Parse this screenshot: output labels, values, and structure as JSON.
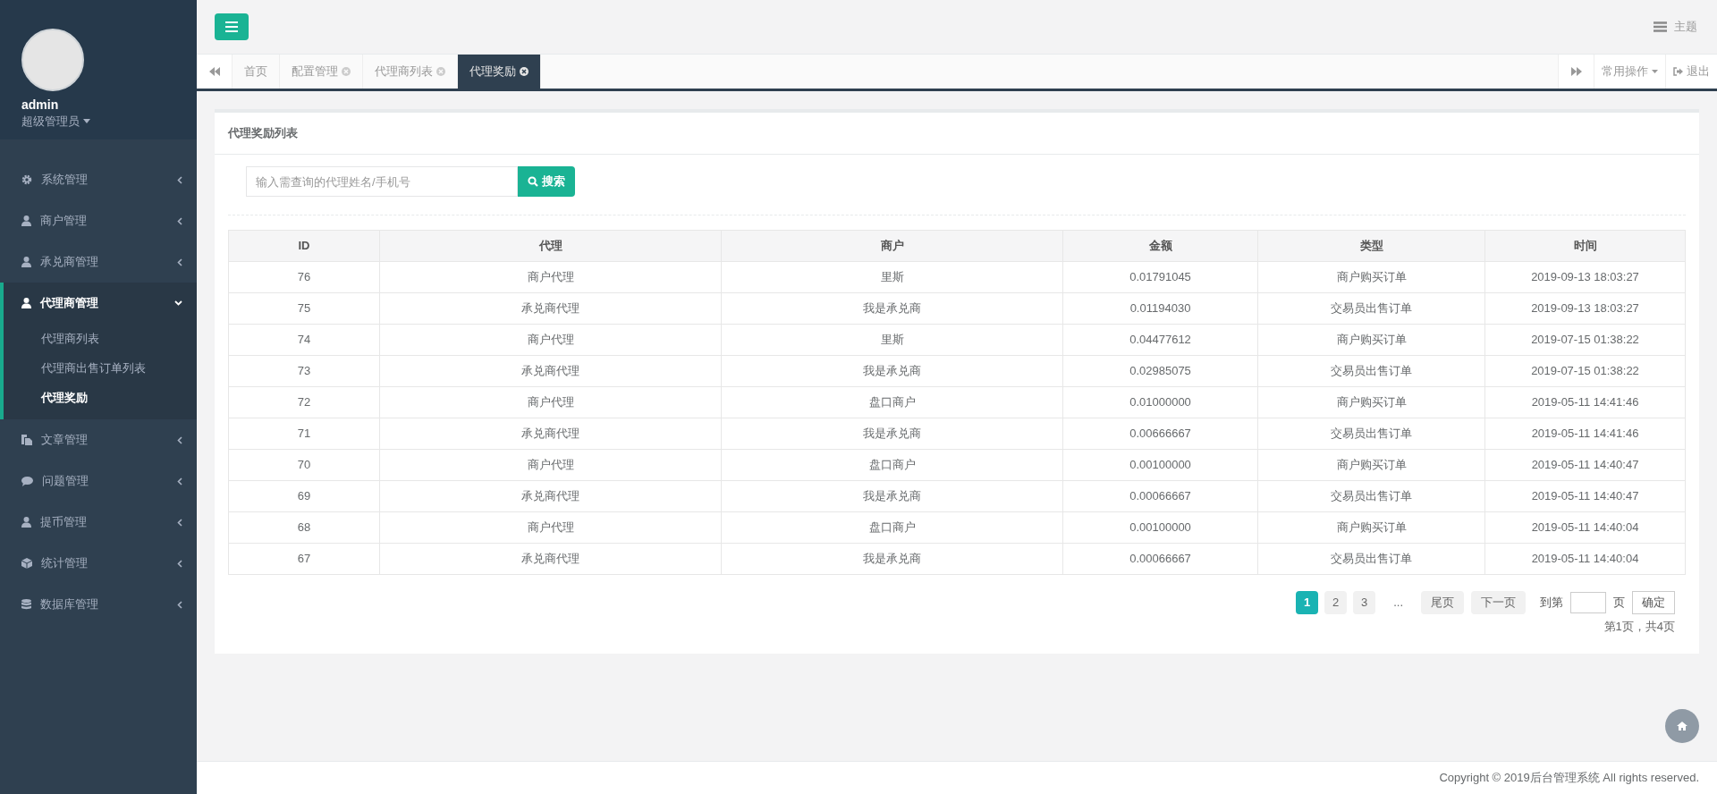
{
  "user": {
    "name": "admin",
    "role": "超级管理员"
  },
  "sidebar": {
    "items": [
      {
        "label": "系统管理",
        "kind": "gear",
        "expanded": false
      },
      {
        "label": "商户管理",
        "kind": "user",
        "expanded": false
      },
      {
        "label": "承兑商管理",
        "kind": "user",
        "expanded": false
      },
      {
        "label": "代理商管理",
        "kind": "user",
        "expanded": true,
        "children": [
          {
            "label": "代理商列表",
            "selected": false
          },
          {
            "label": "代理商出售订单列表",
            "selected": false
          },
          {
            "label": "代理奖励",
            "selected": true
          }
        ]
      },
      {
        "label": "文章管理",
        "kind": "copy",
        "expanded": false
      },
      {
        "label": "问题管理",
        "kind": "comment",
        "expanded": false
      },
      {
        "label": "提币管理",
        "kind": "user",
        "expanded": false
      },
      {
        "label": "统计管理",
        "kind": "cube",
        "expanded": false
      },
      {
        "label": "数据库管理",
        "kind": "database",
        "expanded": false
      }
    ]
  },
  "header": {
    "theme_label": "主题"
  },
  "tabs": [
    {
      "label": "首页",
      "closable": false,
      "selected": false
    },
    {
      "label": "配置管理",
      "closable": true,
      "selected": false
    },
    {
      "label": "代理商列表",
      "closable": true,
      "selected": false
    },
    {
      "label": "代理奖励",
      "closable": true,
      "selected": true
    }
  ],
  "tab_actions": {
    "menu": "常用操作",
    "logout": "退出"
  },
  "panel": {
    "title": "代理奖励列表",
    "search": {
      "placeholder": "输入需查询的代理姓名/手机号",
      "button": "搜索"
    },
    "table": {
      "columns": [
        "ID",
        "代理",
        "商户",
        "金额",
        "类型",
        "时间"
      ],
      "rows": [
        [
          "76",
          "商户代理",
          "里斯",
          "0.01791045",
          "商户购买订单",
          "2019-09-13 18:03:27"
        ],
        [
          "75",
          "承兑商代理",
          "我是承兑商",
          "0.01194030",
          "交易员出售订单",
          "2019-09-13 18:03:27"
        ],
        [
          "74",
          "商户代理",
          "里斯",
          "0.04477612",
          "商户购买订单",
          "2019-07-15 01:38:22"
        ],
        [
          "73",
          "承兑商代理",
          "我是承兑商",
          "0.02985075",
          "交易员出售订单",
          "2019-07-15 01:38:22"
        ],
        [
          "72",
          "商户代理",
          "盘口商户",
          "0.01000000",
          "商户购买订单",
          "2019-05-11 14:41:46"
        ],
        [
          "71",
          "承兑商代理",
          "我是承兑商",
          "0.00666667",
          "交易员出售订单",
          "2019-05-11 14:41:46"
        ],
        [
          "70",
          "商户代理",
          "盘口商户",
          "0.00100000",
          "商户购买订单",
          "2019-05-11 14:40:47"
        ],
        [
          "69",
          "承兑商代理",
          "我是承兑商",
          "0.00066667",
          "交易员出售订单",
          "2019-05-11 14:40:47"
        ],
        [
          "68",
          "商户代理",
          "盘口商户",
          "0.00100000",
          "商户购买订单",
          "2019-05-11 14:40:04"
        ],
        [
          "67",
          "承兑商代理",
          "我是承兑商",
          "0.00066667",
          "交易员出售订单",
          "2019-05-11 14:40:04"
        ]
      ]
    },
    "pagination": {
      "pages": [
        {
          "label": "1",
          "selected": true
        },
        {
          "label": "2",
          "selected": false
        },
        {
          "label": "3",
          "selected": false
        }
      ],
      "ellipsis": "...",
      "last": "尾页",
      "next": "下一页",
      "goto_prefix": "到第",
      "goto_suffix": "页",
      "confirm": "确定",
      "summary": "第1页，共4页"
    }
  },
  "footer": "Copyright © 2019后台管理系统 All rights reserved."
}
